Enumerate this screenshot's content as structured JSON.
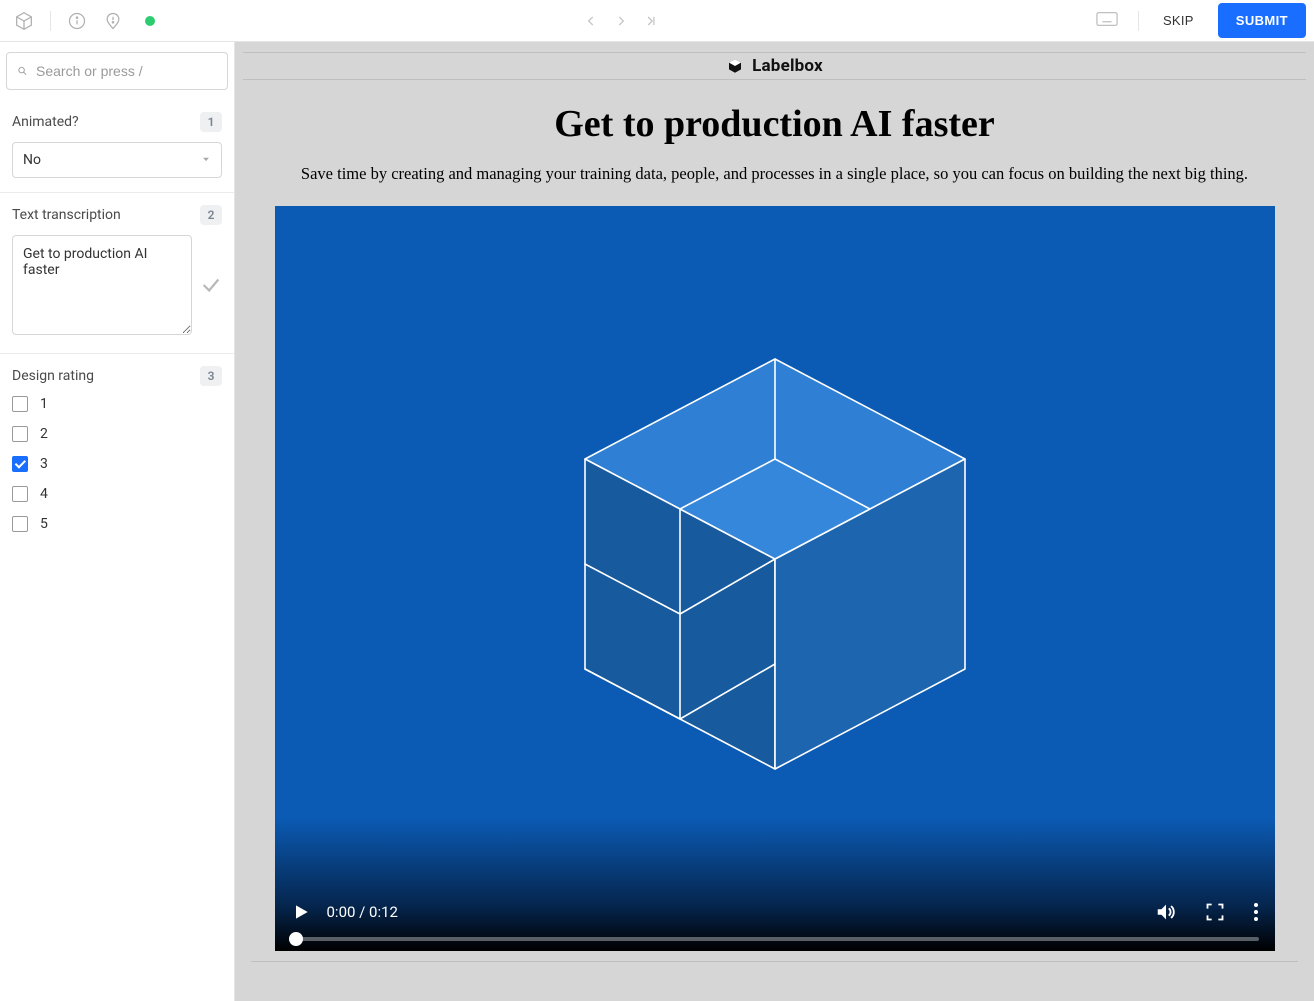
{
  "topbar": {
    "skip_label": "SKIP",
    "submit_label": "SUBMIT"
  },
  "sidebar": {
    "search_placeholder": "Search or press /",
    "q1": {
      "title": "Animated?",
      "badge": "1",
      "value": "No"
    },
    "q2": {
      "title": "Text transcription",
      "badge": "2",
      "value": "Get to production AI faster"
    },
    "q3": {
      "title": "Design rating",
      "badge": "3",
      "options": [
        {
          "label": "1",
          "checked": false
        },
        {
          "label": "2",
          "checked": false
        },
        {
          "label": "3",
          "checked": true
        },
        {
          "label": "4",
          "checked": false
        },
        {
          "label": "5",
          "checked": false
        }
      ]
    }
  },
  "content": {
    "brand": "Labelbox",
    "headline": "Get to production AI faster",
    "subhead": "Save time by creating and managing your training data, people, and processes in a single place, so you can focus on building the next big thing.",
    "video": {
      "current_time": "0:00",
      "duration": "0:12",
      "time_display": "0:00 / 0:12"
    }
  }
}
